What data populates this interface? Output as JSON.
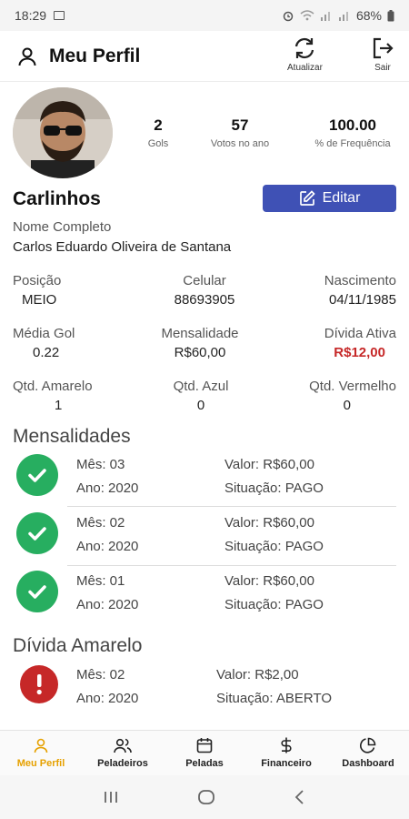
{
  "status_bar": {
    "time": "18:29",
    "battery": "68%"
  },
  "header": {
    "title": "Meu Perfil",
    "refresh_label": "Atualizar",
    "exit_label": "Sair"
  },
  "profile": {
    "stats": [
      {
        "value": "2",
        "label": "Gols"
      },
      {
        "value": "57",
        "label": "Votos no ano"
      },
      {
        "value": "100.00",
        "label": "% de Frequência"
      }
    ],
    "nickname": "Carlinhos",
    "edit_label": "Editar",
    "full_name_label": "Nome Completo",
    "full_name": "Carlos Eduardo Oliveira de Santana"
  },
  "info": {
    "posicao": {
      "label": "Posição",
      "value": "MEIO"
    },
    "celular": {
      "label": "Celular",
      "value": "88693905"
    },
    "nascimento": {
      "label": "Nascimento",
      "value": "04/11/1985"
    },
    "media_gol": {
      "label": "Média Gol",
      "value": "0.22"
    },
    "mensalidade": {
      "label": "Mensalidade",
      "value": "R$60,00"
    },
    "divida_ativa": {
      "label": "Dívida Ativa",
      "value": "R$12,00"
    },
    "amarelo": {
      "label": "Qtd. Amarelo",
      "value": "1"
    },
    "azul": {
      "label": "Qtd. Azul",
      "value": "0"
    },
    "vermelho": {
      "label": "Qtd. Vermelho",
      "value": "0"
    }
  },
  "mensalidades": {
    "title": "Mensalidades",
    "items": [
      {
        "mes": "Mês: 03",
        "ano": "Ano: 2020",
        "valor": "Valor: R$60,00",
        "situacao": "Situação: PAGO"
      },
      {
        "mes": "Mês: 02",
        "ano": "Ano: 2020",
        "valor": "Valor: R$60,00",
        "situacao": "Situação: PAGO"
      },
      {
        "mes": "Mês: 01",
        "ano": "Ano: 2020",
        "valor": "Valor: R$60,00",
        "situacao": "Situação: PAGO"
      }
    ]
  },
  "divida_amarelo": {
    "title": "Dívida Amarelo",
    "items": [
      {
        "mes": "Mês: 02",
        "ano": "Ano: 2020",
        "valor": "Valor: R$2,00",
        "situacao": "Situação: ABERTO"
      }
    ]
  },
  "bottom_nav": {
    "items": [
      {
        "label": "Meu Perfil"
      },
      {
        "label": "Peladeiros"
      },
      {
        "label": "Peladas"
      },
      {
        "label": "Financeiro"
      },
      {
        "label": "Dashboard"
      }
    ]
  },
  "colors": {
    "accent": "#3f51b5",
    "active_tab": "#e6a100",
    "paid_green": "#27ae60",
    "debt_red": "#c62828"
  }
}
